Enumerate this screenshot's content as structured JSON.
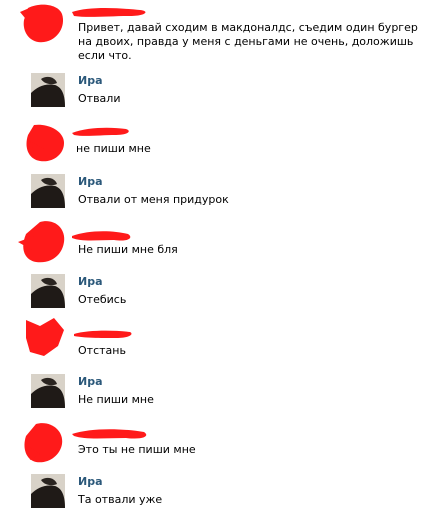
{
  "colors": {
    "author_name": "#2b587a",
    "redaction": "#ff1a1a",
    "message_text": "#000000",
    "background": "#ffffff"
  },
  "messages": [
    {
      "sender": "",
      "redacted": true,
      "text": "Привет, давай сходим в макдоналдс, съедим один бургер на двоих, правда у меня с деньгами не очень, доложишь если что."
    },
    {
      "sender": "Ира",
      "redacted": false,
      "avatar_icon": "user-avatar-photo",
      "text": "Отвали"
    },
    {
      "sender": "",
      "redacted": true,
      "text": "не пиши мне"
    },
    {
      "sender": "Ира",
      "redacted": false,
      "avatar_icon": "user-avatar-photo",
      "text": "Отвали от меня придурок"
    },
    {
      "sender": "",
      "redacted": true,
      "text": "Не пиши мне бля"
    },
    {
      "sender": "Ира",
      "redacted": false,
      "avatar_icon": "user-avatar-photo",
      "text": "Отебись"
    },
    {
      "sender": "",
      "redacted": true,
      "text": "Отстань"
    },
    {
      "sender": "Ира",
      "redacted": false,
      "avatar_icon": "user-avatar-photo",
      "text": "Не пиши мне"
    },
    {
      "sender": "",
      "redacted": true,
      "text": "Это ты не пиши мне"
    },
    {
      "sender": "Ира",
      "redacted": false,
      "avatar_icon": "user-avatar-photo",
      "text": "Та отвали уже"
    }
  ]
}
